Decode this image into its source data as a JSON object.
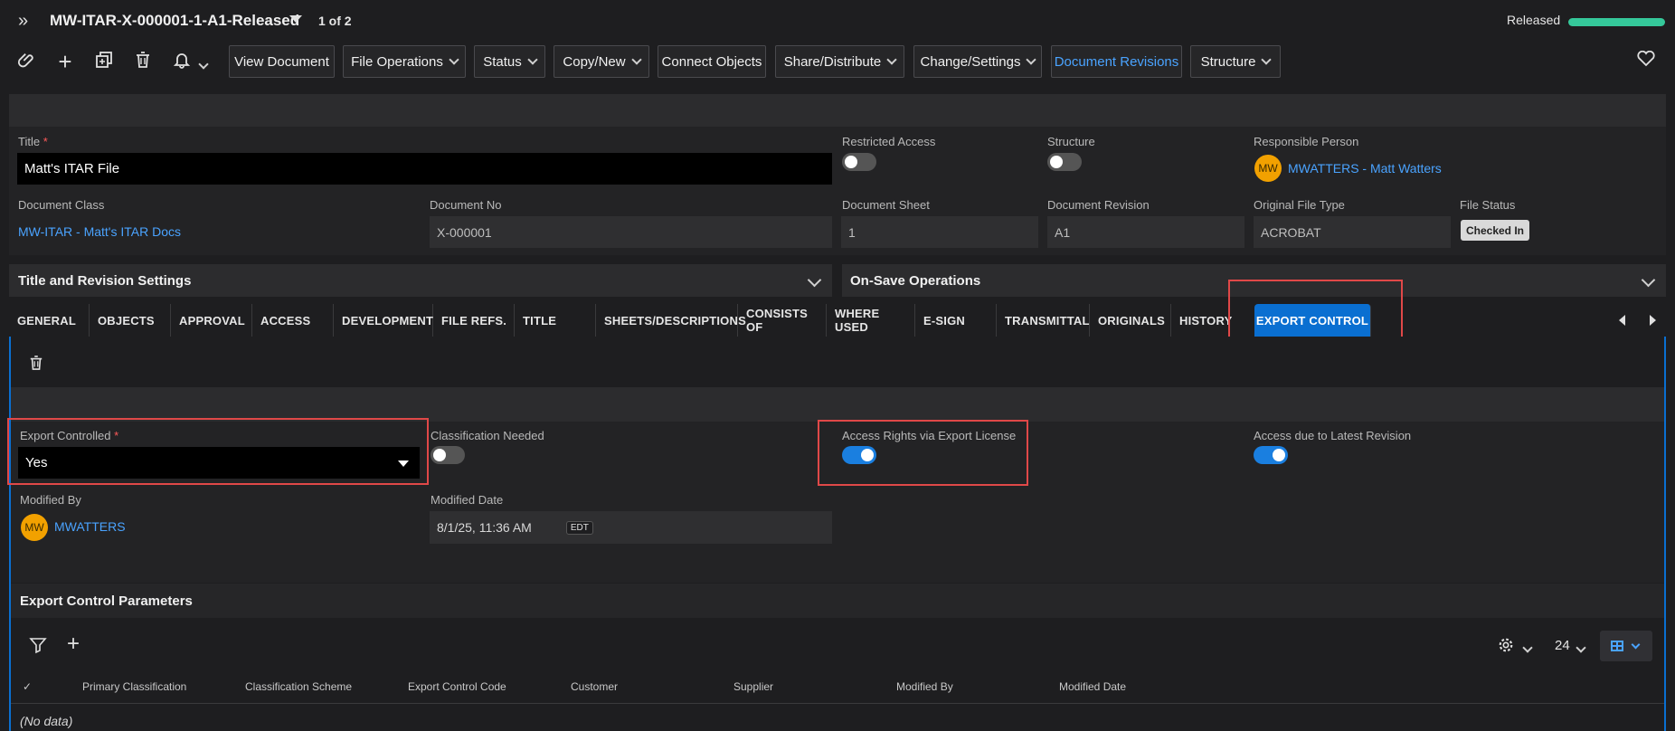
{
  "header": {
    "title": "MW-ITAR-X-000001-1-A1-Released",
    "pager": "1 of 2",
    "status": "Released",
    "status_color": "#35c89a"
  },
  "toolbar": {
    "icons": [
      "attach-icon",
      "add-icon",
      "duplicate-icon",
      "delete-icon",
      "bell-icon"
    ],
    "buttons": [
      {
        "label": "View Document"
      },
      {
        "label": "File Operations"
      },
      {
        "label": "Status"
      },
      {
        "label": "Copy/New"
      },
      {
        "label": "Connect Objects"
      },
      {
        "label": "Share/Distribute"
      },
      {
        "label": "Change/Settings"
      },
      {
        "label": "Document Revisions"
      },
      {
        "label": "Structure"
      }
    ]
  },
  "form": {
    "title_label": "Title",
    "title_value": "Matt's ITAR File",
    "restricted_access_label": "Restricted Access",
    "restricted_access": false,
    "structure_label": "Structure",
    "structure": false,
    "responsible_person_label": "Responsible Person",
    "responsible_person_initials": "MW",
    "responsible_person": "MWATTERS - Matt Watters",
    "document_class_label": "Document Class",
    "document_class": "MW-ITAR - Matt's ITAR Docs",
    "document_no_label": "Document No",
    "document_no": "X-000001",
    "document_sheet_label": "Document Sheet",
    "document_sheet": "1",
    "document_revision_label": "Document Revision",
    "document_revision": "A1",
    "original_file_type_label": "Original File Type",
    "original_file_type": "ACROBAT",
    "file_status_label": "File Status",
    "file_status": "Checked In"
  },
  "sections": {
    "title_revision": "Title and Revision Settings",
    "on_save": "On-Save Operations"
  },
  "tabs": [
    {
      "label": "GENERAL"
    },
    {
      "label": "OBJECTS"
    },
    {
      "label": "APPROVAL"
    },
    {
      "label": "ACCESS"
    },
    {
      "label": "DEVELOPMENT"
    },
    {
      "label": "FILE REFS."
    },
    {
      "label": "TITLE"
    },
    {
      "label": "SHEETS/DESCRIPTIONS"
    },
    {
      "label": "CONSISTS OF"
    },
    {
      "label": "WHERE USED"
    },
    {
      "label": "E-SIGN"
    },
    {
      "label": "TRANSMITTAL"
    },
    {
      "label": "ORIGINALS"
    },
    {
      "label": "HISTORY"
    },
    {
      "label": "EXPORT CONTROL"
    }
  ],
  "export": {
    "export_controlled_label": "Export Controlled",
    "export_controlled": "Yes",
    "classification_needed_label": "Classification Needed",
    "classification_needed": false,
    "access_rights_label": "Access Rights via Export License",
    "access_rights": true,
    "access_latest_label": "Access due to Latest Revision",
    "access_latest": true,
    "modified_by_label": "Modified By",
    "modified_by_initials": "MW",
    "modified_by": "MWATTERS",
    "modified_date_label": "Modified Date",
    "modified_date": "8/1/25, 11:36 AM",
    "timezone": "EDT"
  },
  "params": {
    "title": "Export Control Parameters",
    "page_size": "24",
    "columns": [
      "Primary Classification",
      "Classification Scheme",
      "Export Control Code",
      "Customer",
      "Supplier",
      "Modified By",
      "Modified Date"
    ],
    "checkmark": "✓",
    "empty": "(No data)"
  }
}
